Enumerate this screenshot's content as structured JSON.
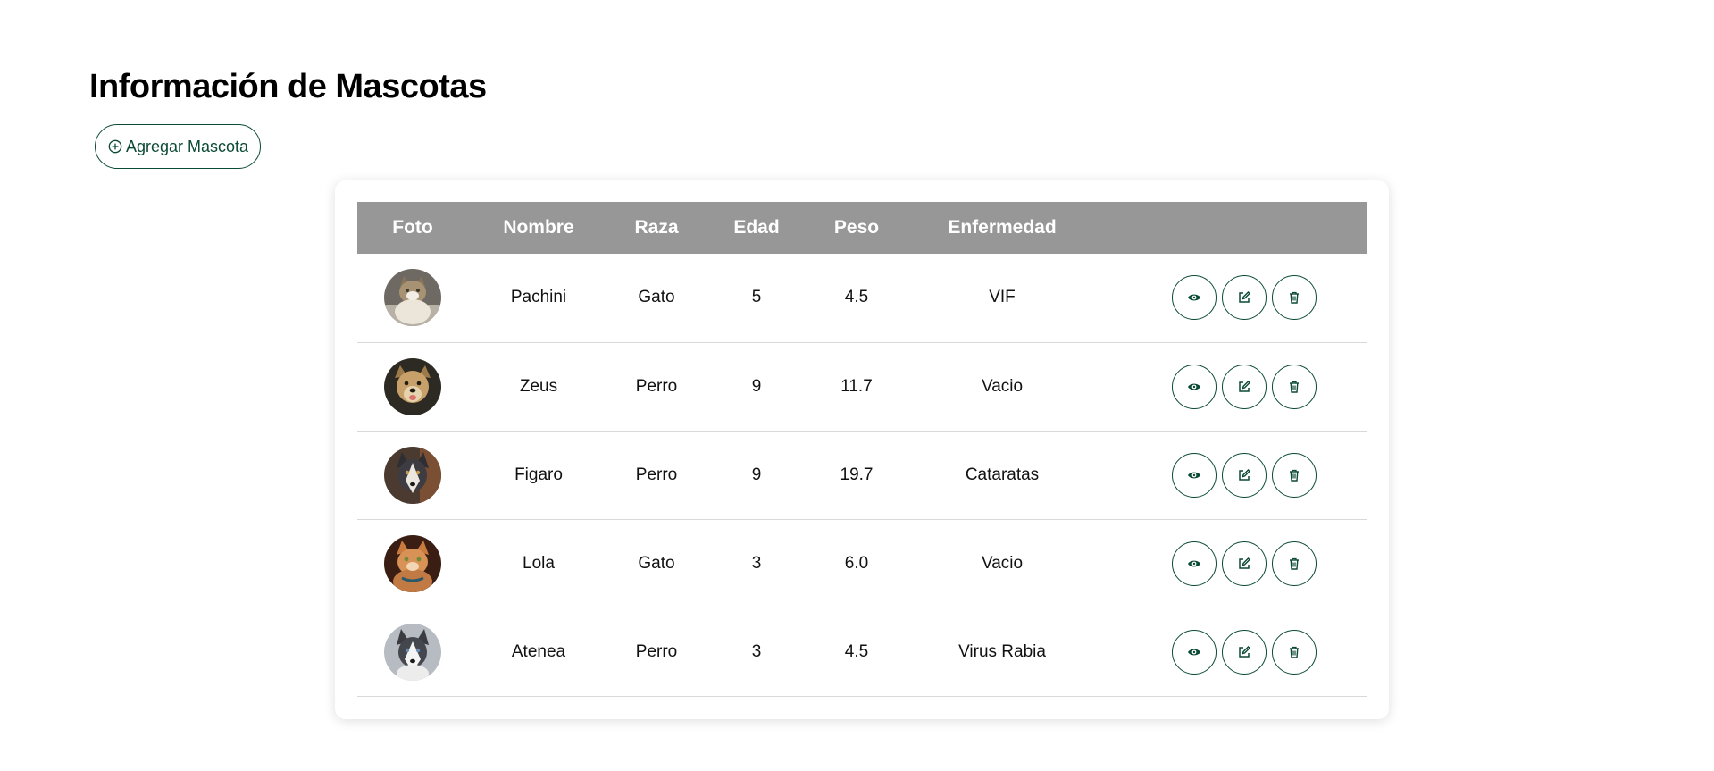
{
  "page": {
    "title": "Información de Mascotas",
    "add_button_label": "Agregar Mascota"
  },
  "table": {
    "headers": [
      "Foto",
      "Nombre",
      "Raza",
      "Edad",
      "Peso",
      "Enfermedad",
      ""
    ],
    "rows": [
      {
        "nombre": "Pachini",
        "raza": "Gato",
        "edad": "5",
        "peso": "4.5",
        "enfermedad": "VIF"
      },
      {
        "nombre": "Zeus",
        "raza": "Perro",
        "edad": "9",
        "peso": "11.7",
        "enfermedad": "Vacio"
      },
      {
        "nombre": "Figaro",
        "raza": "Perro",
        "edad": "9",
        "peso": "19.7",
        "enfermedad": "Cataratas"
      },
      {
        "nombre": "Lola",
        "raza": "Gato",
        "edad": "3",
        "peso": "6.0",
        "enfermedad": "Vacio"
      },
      {
        "nombre": "Atenea",
        "raza": "Perro",
        "edad": "3",
        "peso": "4.5",
        "enfermedad": "Virus Rabia"
      }
    ],
    "row_actions": [
      "eye-icon",
      "edit-icon",
      "trash-icon"
    ]
  },
  "colors": {
    "accent": "#0b4a35",
    "header_bg": "#979797",
    "header_text": "#ffffff"
  },
  "icons": {
    "add_button": "plus-circle-icon"
  }
}
